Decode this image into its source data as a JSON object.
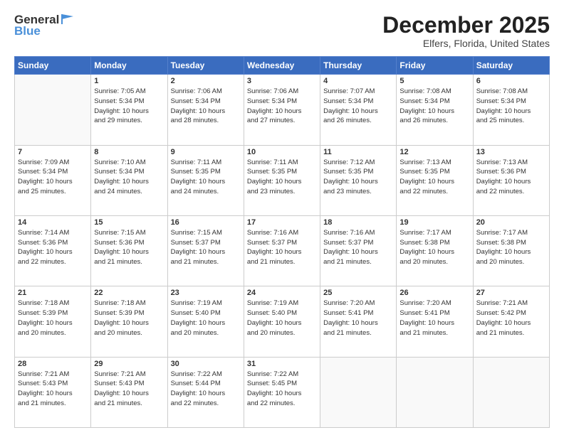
{
  "header": {
    "logo_general": "General",
    "logo_blue": "Blue",
    "title": "December 2025",
    "location": "Elfers, Florida, United States"
  },
  "weekdays": [
    "Sunday",
    "Monday",
    "Tuesday",
    "Wednesday",
    "Thursday",
    "Friday",
    "Saturday"
  ],
  "weeks": [
    [
      {
        "day": "",
        "info": ""
      },
      {
        "day": "1",
        "info": "Sunrise: 7:05 AM\nSunset: 5:34 PM\nDaylight: 10 hours\nand 29 minutes."
      },
      {
        "day": "2",
        "info": "Sunrise: 7:06 AM\nSunset: 5:34 PM\nDaylight: 10 hours\nand 28 minutes."
      },
      {
        "day": "3",
        "info": "Sunrise: 7:06 AM\nSunset: 5:34 PM\nDaylight: 10 hours\nand 27 minutes."
      },
      {
        "day": "4",
        "info": "Sunrise: 7:07 AM\nSunset: 5:34 PM\nDaylight: 10 hours\nand 26 minutes."
      },
      {
        "day": "5",
        "info": "Sunrise: 7:08 AM\nSunset: 5:34 PM\nDaylight: 10 hours\nand 26 minutes."
      },
      {
        "day": "6",
        "info": "Sunrise: 7:08 AM\nSunset: 5:34 PM\nDaylight: 10 hours\nand 25 minutes."
      }
    ],
    [
      {
        "day": "7",
        "info": "Sunrise: 7:09 AM\nSunset: 5:34 PM\nDaylight: 10 hours\nand 25 minutes."
      },
      {
        "day": "8",
        "info": "Sunrise: 7:10 AM\nSunset: 5:34 PM\nDaylight: 10 hours\nand 24 minutes."
      },
      {
        "day": "9",
        "info": "Sunrise: 7:11 AM\nSunset: 5:35 PM\nDaylight: 10 hours\nand 24 minutes."
      },
      {
        "day": "10",
        "info": "Sunrise: 7:11 AM\nSunset: 5:35 PM\nDaylight: 10 hours\nand 23 minutes."
      },
      {
        "day": "11",
        "info": "Sunrise: 7:12 AM\nSunset: 5:35 PM\nDaylight: 10 hours\nand 23 minutes."
      },
      {
        "day": "12",
        "info": "Sunrise: 7:13 AM\nSunset: 5:35 PM\nDaylight: 10 hours\nand 22 minutes."
      },
      {
        "day": "13",
        "info": "Sunrise: 7:13 AM\nSunset: 5:36 PM\nDaylight: 10 hours\nand 22 minutes."
      }
    ],
    [
      {
        "day": "14",
        "info": "Sunrise: 7:14 AM\nSunset: 5:36 PM\nDaylight: 10 hours\nand 22 minutes."
      },
      {
        "day": "15",
        "info": "Sunrise: 7:15 AM\nSunset: 5:36 PM\nDaylight: 10 hours\nand 21 minutes."
      },
      {
        "day": "16",
        "info": "Sunrise: 7:15 AM\nSunset: 5:37 PM\nDaylight: 10 hours\nand 21 minutes."
      },
      {
        "day": "17",
        "info": "Sunrise: 7:16 AM\nSunset: 5:37 PM\nDaylight: 10 hours\nand 21 minutes."
      },
      {
        "day": "18",
        "info": "Sunrise: 7:16 AM\nSunset: 5:37 PM\nDaylight: 10 hours\nand 21 minutes."
      },
      {
        "day": "19",
        "info": "Sunrise: 7:17 AM\nSunset: 5:38 PM\nDaylight: 10 hours\nand 20 minutes."
      },
      {
        "day": "20",
        "info": "Sunrise: 7:17 AM\nSunset: 5:38 PM\nDaylight: 10 hours\nand 20 minutes."
      }
    ],
    [
      {
        "day": "21",
        "info": "Sunrise: 7:18 AM\nSunset: 5:39 PM\nDaylight: 10 hours\nand 20 minutes."
      },
      {
        "day": "22",
        "info": "Sunrise: 7:18 AM\nSunset: 5:39 PM\nDaylight: 10 hours\nand 20 minutes."
      },
      {
        "day": "23",
        "info": "Sunrise: 7:19 AM\nSunset: 5:40 PM\nDaylight: 10 hours\nand 20 minutes."
      },
      {
        "day": "24",
        "info": "Sunrise: 7:19 AM\nSunset: 5:40 PM\nDaylight: 10 hours\nand 20 minutes."
      },
      {
        "day": "25",
        "info": "Sunrise: 7:20 AM\nSunset: 5:41 PM\nDaylight: 10 hours\nand 21 minutes."
      },
      {
        "day": "26",
        "info": "Sunrise: 7:20 AM\nSunset: 5:41 PM\nDaylight: 10 hours\nand 21 minutes."
      },
      {
        "day": "27",
        "info": "Sunrise: 7:21 AM\nSunset: 5:42 PM\nDaylight: 10 hours\nand 21 minutes."
      }
    ],
    [
      {
        "day": "28",
        "info": "Sunrise: 7:21 AM\nSunset: 5:43 PM\nDaylight: 10 hours\nand 21 minutes."
      },
      {
        "day": "29",
        "info": "Sunrise: 7:21 AM\nSunset: 5:43 PM\nDaylight: 10 hours\nand 21 minutes."
      },
      {
        "day": "30",
        "info": "Sunrise: 7:22 AM\nSunset: 5:44 PM\nDaylight: 10 hours\nand 22 minutes."
      },
      {
        "day": "31",
        "info": "Sunrise: 7:22 AM\nSunset: 5:45 PM\nDaylight: 10 hours\nand 22 minutes."
      },
      {
        "day": "",
        "info": ""
      },
      {
        "day": "",
        "info": ""
      },
      {
        "day": "",
        "info": ""
      }
    ]
  ]
}
